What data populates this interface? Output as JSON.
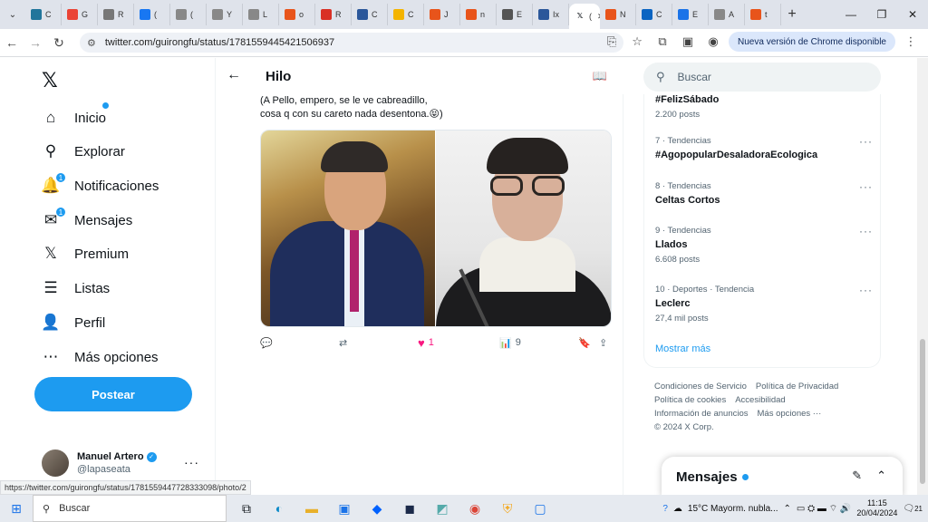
{
  "browser": {
    "tabs": [
      {
        "title": "C",
        "icon": "wordpress-icon",
        "color": "#21759b"
      },
      {
        "title": "G",
        "icon": "chrome-recorder-icon",
        "color": "#ea4335"
      },
      {
        "title": "R",
        "icon": "news-icon",
        "color": "#777777"
      },
      {
        "title": "(",
        "icon": "facebook-icon",
        "color": "#1877f2"
      },
      {
        "title": "(",
        "icon": "gmail-icon",
        "color": "#888888"
      },
      {
        "title": "Y",
        "icon": "mail-icon",
        "color": "#888888"
      },
      {
        "title": "L",
        "icon": "photo-icon",
        "color": "#888888"
      },
      {
        "title": "o",
        "icon": "record-icon",
        "color": "#e8541b"
      },
      {
        "title": "R",
        "icon": "gmail-icon",
        "color": "#d93025"
      },
      {
        "title": "C",
        "icon": "word-icon",
        "color": "#2b579a"
      },
      {
        "title": "C",
        "icon": "calendar-icon",
        "color": "#f4b400"
      },
      {
        "title": "J",
        "icon": "record-icon",
        "color": "#e8541b"
      },
      {
        "title": "n",
        "icon": "record-icon",
        "color": "#e8541b"
      },
      {
        "title": "E",
        "icon": "globe-icon",
        "color": "#555555"
      },
      {
        "title": "Ix",
        "icon": "word-icon",
        "color": "#2b579a"
      },
      {
        "title": "(",
        "icon": "x-icon",
        "color": "#0f1419",
        "active": true
      },
      {
        "title": "N",
        "icon": "record-icon",
        "color": "#e8541b"
      },
      {
        "title": "C",
        "icon": "outlook-icon",
        "color": "#0a64c2"
      },
      {
        "title": "E",
        "icon": "doc-icon",
        "color": "#1a73e8"
      },
      {
        "title": "A",
        "icon": "mail-icon",
        "color": "#888888"
      },
      {
        "title": "t",
        "icon": "record-icon",
        "color": "#e8541b"
      }
    ],
    "url": "twitter.com/guirongfu/status/1781559445421506937",
    "update_label": "Nueva versión de Chrome disponible",
    "status_url": "https://twitter.com/guirongfu/status/1781559447728333098/photo/2"
  },
  "nav": {
    "items": [
      {
        "label": "Inicio",
        "icon": "home-icon",
        "glyph": "⌂",
        "dot": true
      },
      {
        "label": "Explorar",
        "icon": "search-icon",
        "glyph": "⚲"
      },
      {
        "label": "Notificaciones",
        "icon": "bell-icon",
        "glyph": "🔔",
        "badge": "1"
      },
      {
        "label": "Mensajes",
        "icon": "envelope-icon",
        "glyph": "✉",
        "badge": "1"
      },
      {
        "label": "Premium",
        "icon": "x-logo-icon",
        "glyph": "𝕏"
      },
      {
        "label": "Listas",
        "icon": "list-icon",
        "glyph": "☰"
      },
      {
        "label": "Perfil",
        "icon": "person-icon",
        "glyph": "👤"
      },
      {
        "label": "Más opciones",
        "icon": "more-circle-icon",
        "glyph": "⋯"
      }
    ],
    "post_label": "Postear",
    "user": {
      "name": "Manuel Artero",
      "handle": "@lapaseata"
    }
  },
  "thread": {
    "title": "Hilo",
    "text_line1": "(A Pello, empero, se le ve cabreadillo,",
    "text_line2": "cosa q con su careto nada desentona.",
    "emoji": "😝",
    "text_end": ")",
    "likes": "1",
    "views": "9"
  },
  "sidebar": {
    "search_placeholder": "Buscar",
    "trends": [
      {
        "meta": "",
        "name": "#FelizSábado",
        "count": "2.200 posts"
      },
      {
        "meta": "7 · Tendencias",
        "name": "#AgopopularDesaladoraEcologica",
        "count": ""
      },
      {
        "meta": "8 · Tendencias",
        "name": "Celtas Cortos",
        "count": ""
      },
      {
        "meta": "9 · Tendencias",
        "name": "Llados",
        "count": "6.608 posts"
      },
      {
        "meta": "10 · Deportes · Tendencia",
        "name": "Leclerc",
        "count": "27,4 mil posts"
      }
    ],
    "show_more": "Mostrar más",
    "footer": [
      "Condiciones de Servicio",
      "Política de Privacidad",
      "Política de cookies",
      "Accesibilidad",
      "Información de anuncios",
      "Más opciones ···",
      "© 2024 X Corp."
    ],
    "messages_title": "Mensajes"
  },
  "taskbar": {
    "search_placeholder": "Buscar",
    "weather": "15°C  Mayorm. nubla...",
    "time": "11:15",
    "date": "20/04/2024",
    "notif_count": "21"
  }
}
